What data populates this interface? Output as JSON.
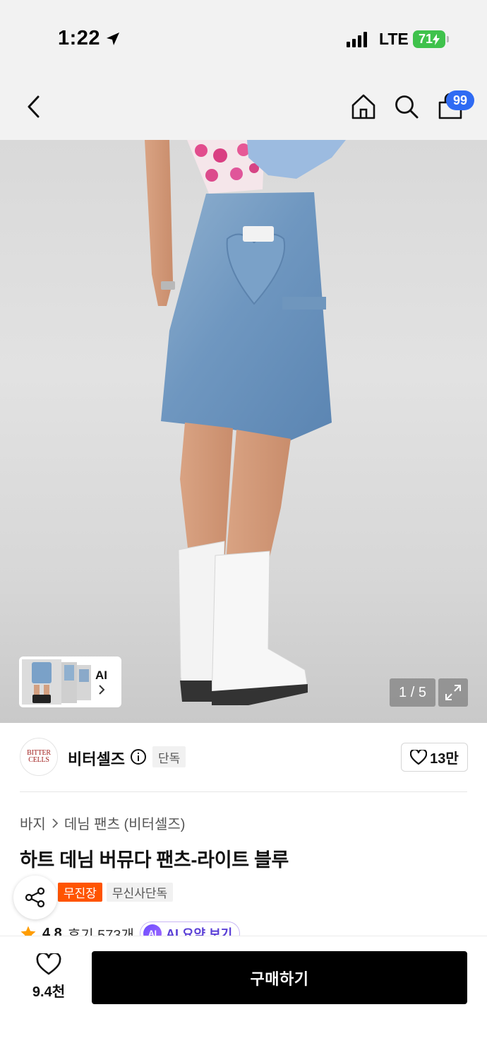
{
  "status_bar": {
    "time": "1:22",
    "network": "LTE",
    "battery": "71"
  },
  "nav": {
    "cart_count": "99"
  },
  "gallery": {
    "counter": "1 / 5",
    "ai_label": "AI"
  },
  "brand": {
    "logo_text": "BITTER CELLS",
    "name": "비터셀즈",
    "exclusive_tag": "단독",
    "likes": "13만"
  },
  "product": {
    "breadcrumb": [
      "바지",
      "데님 팬츠 (비터셀즈)"
    ],
    "title": "하트 데님 버뮤다 팬츠-라이트 블루",
    "tags": [
      "무진장",
      "무신사단독"
    ],
    "rating": "4.8",
    "reviews": "후기 573개",
    "ai_summary_label": "AI 요약 보기",
    "ai_badge": "AI"
  },
  "bottom_bar": {
    "wish_count": "9.4천",
    "buy_label": "구매하기"
  },
  "colors": {
    "accent_blue": "#2f6bf3",
    "tag_orange": "#ff5400",
    "battery_green": "#3fc24c",
    "ai_purple": "#5a3fd6"
  }
}
